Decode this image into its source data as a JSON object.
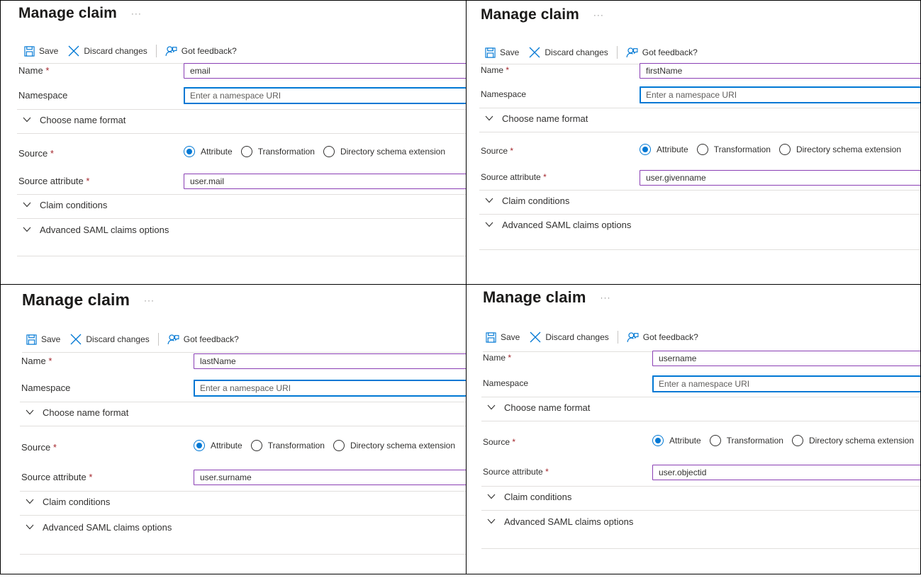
{
  "common": {
    "title": "Manage claim",
    "more": "···",
    "save": "Save",
    "discard": "Discard changes",
    "feedback": "Got feedback?",
    "name_label": "Name",
    "namespace_label": "Namespace",
    "namespace_placeholder": "Enter a namespace URI",
    "choose_name_format": "Choose name format",
    "source_label": "Source",
    "source_attribute_label": "Source attribute",
    "radio_attribute": "Attribute",
    "radio_transformation": "Transformation",
    "radio_directory": "Directory schema extension",
    "claim_conditions": "Claim conditions",
    "advanced_saml": "Advanced SAML claims options",
    "required_mark": "*"
  },
  "panels": [
    {
      "name_value": "email",
      "source_attribute_value": "user.mail"
    },
    {
      "name_value": "firstName",
      "source_attribute_value": "user.givenname"
    },
    {
      "name_value": "lastName",
      "source_attribute_value": "user.surname"
    },
    {
      "name_value": "username",
      "source_attribute_value": "user.objectid"
    }
  ],
  "colors": {
    "accent": "#0078d4",
    "required": "#a4262c",
    "input_border_active": "#8a3fb4"
  }
}
